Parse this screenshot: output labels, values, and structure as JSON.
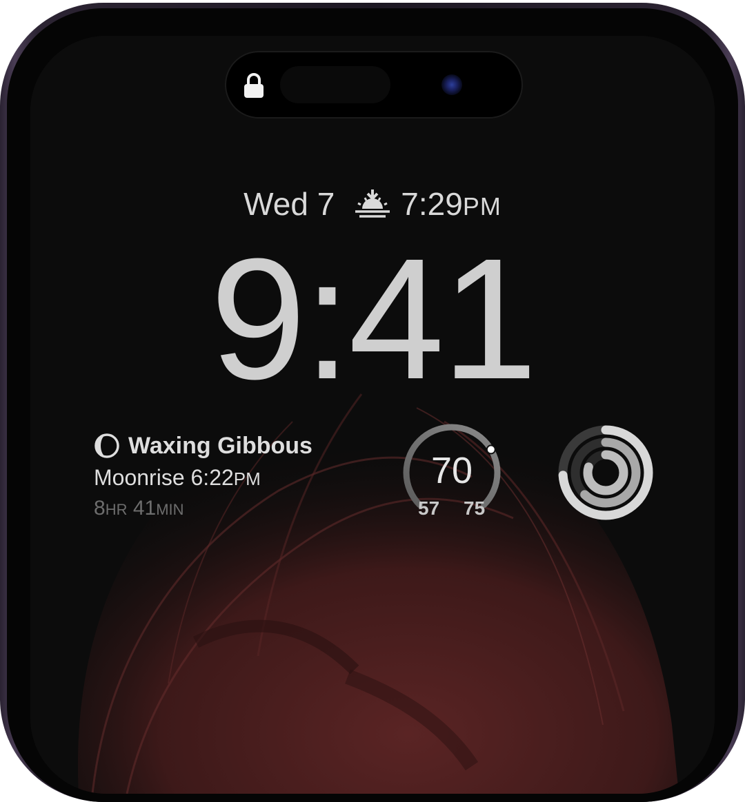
{
  "lock_screen": {
    "date": "Wed 7",
    "sunset_icon": "sunset-icon",
    "sunset_time": "7:29",
    "sunset_ampm": "PM",
    "clock": "9:41"
  },
  "moon_widget": {
    "icon": "moon-phase-icon",
    "phase": "Waxing Gibbous",
    "moonrise_label": "Moonrise 6:22",
    "moonrise_ampm": "PM",
    "duration_hours": "8",
    "duration_hours_unit": "HR",
    "duration_minutes": "41",
    "duration_minutes_unit": "MIN"
  },
  "temperature_widget": {
    "current": "70",
    "low": "57",
    "high": "75",
    "current_fraction": 0.72
  },
  "activity_widget": {
    "icon": "activity-rings-icon",
    "move_fraction": 0.74,
    "exercise_fraction": 0.62,
    "stand_fraction": 0.8
  },
  "colors": {
    "frame": "#2c2433",
    "screen_background": "#0c0c0c",
    "wallpaper_hair": "#4e1f1f",
    "text": "#d9d9d9",
    "secondary_text": "#6d6d6d"
  }
}
